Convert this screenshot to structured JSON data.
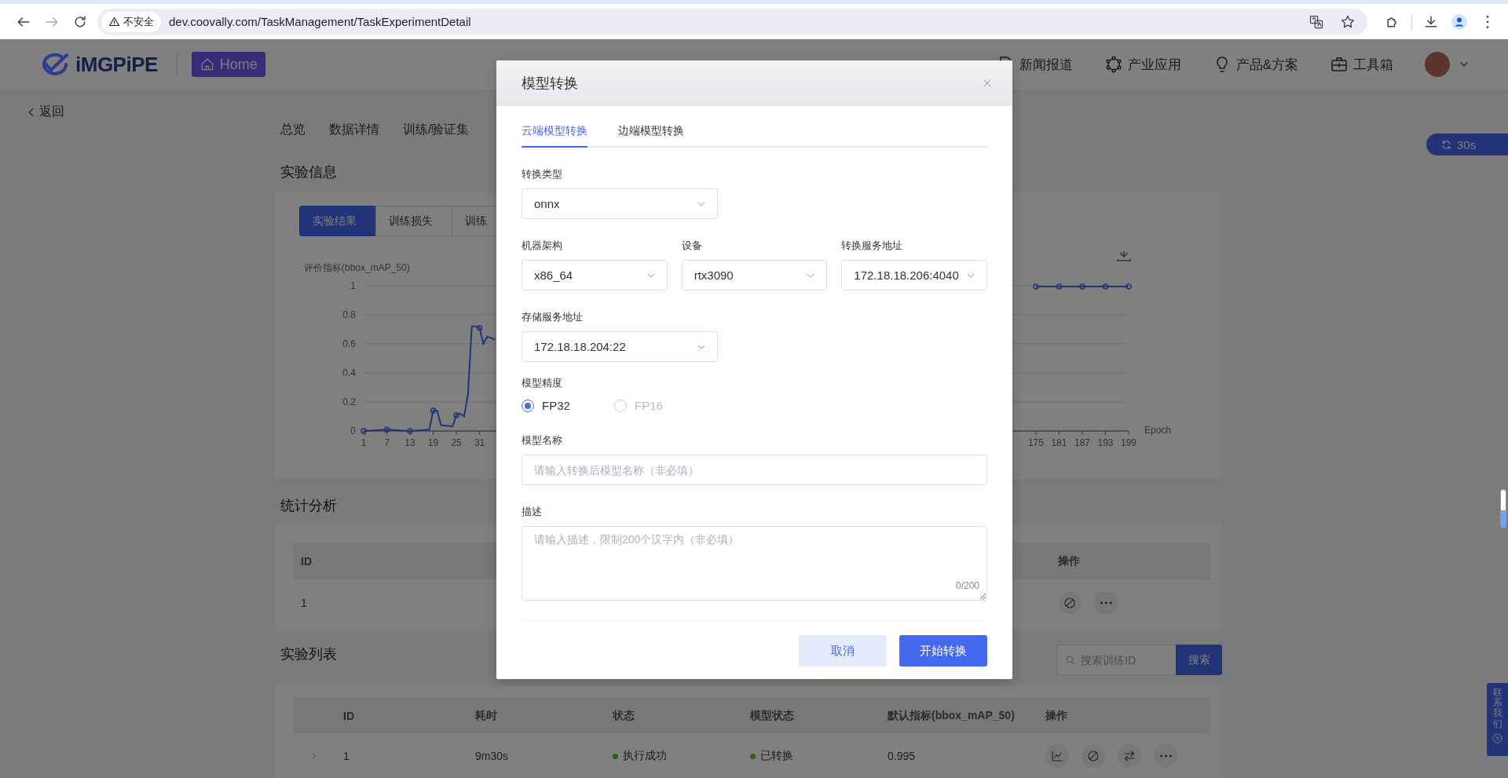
{
  "browser": {
    "security_label": "不安全",
    "url": "dev.coovally.com/TaskManagement/TaskExperimentDetail"
  },
  "header": {
    "logo_text": "iMGPiPE",
    "home_button": "Home",
    "nav": [
      {
        "label": "新闻报道"
      },
      {
        "label": "产业应用"
      },
      {
        "label": "产品&方案"
      },
      {
        "label": "工具箱"
      }
    ]
  },
  "back_link": "返回",
  "page_tabs": [
    {
      "label": "总览"
    },
    {
      "label": "数据详情"
    },
    {
      "label": "训练/验证集"
    }
  ],
  "refresh_badge": "30s",
  "experiment_info": {
    "title": "实验信息",
    "chart_tabs": [
      {
        "label": "实验结果",
        "selected": true
      },
      {
        "label": "训练损失",
        "selected": false
      },
      {
        "label": "训练",
        "selected": false
      }
    ],
    "chart_data": {
      "type": "line",
      "ylabel": "评价指标(bbox_mAP_50)",
      "xlabel": "Epoch",
      "x": [
        1,
        7,
        13,
        18,
        19,
        20,
        21,
        23,
        24,
        25,
        26,
        27,
        28,
        29,
        30,
        31,
        32,
        33,
        34,
        35,
        36,
        175,
        181,
        187,
        193,
        199
      ],
      "series": [
        {
          "color": "#223477",
          "values": [
            0,
            0.01,
            0,
            0.01,
            0.14,
            0.14,
            0.04,
            0.035,
            0.03,
            0.11,
            0.12,
            0.1,
            0.25,
            0.72,
            0.72,
            0.71,
            0.6,
            0.65,
            0.64,
            0.63,
            null,
            0.995,
            0.995,
            0.995,
            0.995,
            0.995
          ]
        }
      ],
      "xticks": [
        1,
        7,
        13,
        19,
        25,
        31,
        175,
        181,
        187,
        193,
        199
      ],
      "yticks": [
        0,
        0.2,
        0.4,
        0.6,
        0.8,
        1
      ],
      "xlim": [
        1,
        199
      ],
      "ylim": [
        0,
        1
      ],
      "grid": true
    }
  },
  "stats": {
    "title": "统计分析",
    "columns": [
      "ID",
      "操作"
    ],
    "rows": [
      {
        "label": "1"
      }
    ]
  },
  "experiments": {
    "title": "实验列表",
    "search_placeholder": "搜索训练ID",
    "search_button": "搜索",
    "columns": [
      "ID",
      "耗时",
      "状态",
      "模型状态",
      "默认指标(bbox_mAP_50)",
      "操作"
    ],
    "rows": [
      {
        "label": "1",
        "duration": "9m30s",
        "status": {
          "text": "执行成功",
          "color": "#29620d"
        },
        "model_status": {
          "text": "已转换",
          "color": "#29620d"
        },
        "metric": "0.995"
      }
    ]
  },
  "contact_tab": "联系我们",
  "dialog": {
    "title": "模型转换",
    "tabs": [
      {
        "label": "云端模型转换",
        "selected": true
      },
      {
        "label": "边端模型转换",
        "selected": false
      }
    ],
    "rows": [
      {
        "fields": [
          {
            "kind": "select",
            "label": "转换类型",
            "value": "onnx"
          }
        ]
      },
      {
        "fields": [
          {
            "kind": "select",
            "label": "机器架构",
            "value": "x86_64"
          },
          {
            "kind": "select",
            "label": "设备",
            "value": "rtx3090"
          },
          {
            "kind": "select",
            "label": "转换服务地址",
            "value": "172.18.18.206:4040"
          }
        ]
      },
      {
        "fields": [
          {
            "kind": "select",
            "label": "存储服务地址",
            "value": "172.18.18.204:22"
          }
        ]
      },
      {
        "fields": [
          {
            "kind": "radio",
            "label": "模型精度",
            "options": [
              {
                "label": "FP32",
                "selected": true,
                "disabled": false
              },
              {
                "label": "FP16",
                "selected": false,
                "disabled": true
              }
            ]
          }
        ]
      },
      {
        "fields": [
          {
            "kind": "input",
            "label": "模型名称",
            "placeholder": "请输入转换后模型名称（非必填）"
          }
        ]
      },
      {
        "fields": [
          {
            "kind": "textarea",
            "label": "描述",
            "placeholder": "请输入描述，限制200个汉字内（非必填）",
            "counter": "0/200"
          }
        ]
      }
    ],
    "buttons": [
      {
        "label": "取消",
        "kind": "secondary"
      },
      {
        "label": "开始转换",
        "kind": "primary"
      }
    ]
  }
}
